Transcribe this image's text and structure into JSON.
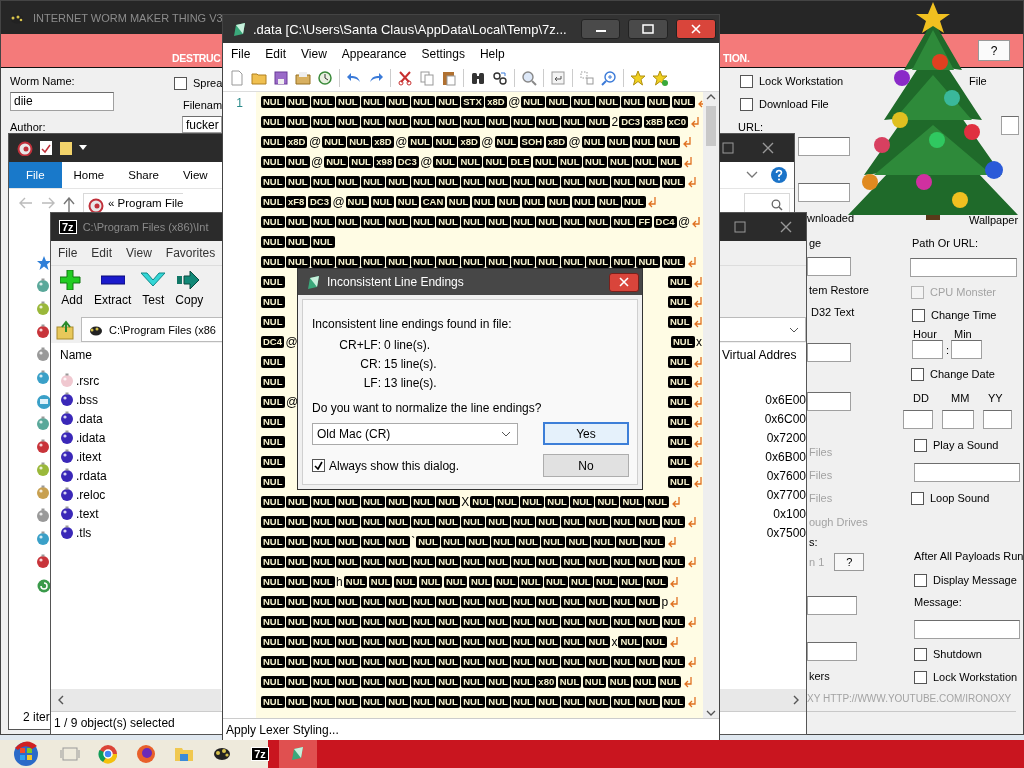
{
  "worm_window": {
    "title": "INTERNET WORM MAKER THING V3",
    "banner": [
      "DESTRUC",
      "TION."
    ],
    "help_button": "?",
    "controls": [
      {
        "kind": "label",
        "text": "Worm Name:",
        "disabled": false
      },
      {
        "kind": "field",
        "value": "diie"
      },
      {
        "kind": "label",
        "text": "Author:",
        "disabled": false
      },
      {
        "kind": "checkbox",
        "text": "Sprea",
        "checked": false,
        "disabled": false
      },
      {
        "kind": "label",
        "text": "Filenam",
        "disabled": false
      },
      {
        "kind": "field",
        "value": "fucker"
      },
      {
        "kind": "checkbox",
        "text": "Lock Workstation",
        "checked": false,
        "disabled": false
      },
      {
        "kind": "checkbox",
        "text": "Download File",
        "checked": false,
        "disabled": false
      },
      {
        "kind": "label",
        "text": "URL:",
        "disabled": false
      },
      {
        "kind": "label",
        "text": "File",
        "disabled": false
      },
      {
        "kind": "field"
      },
      {
        "kind": "field"
      },
      {
        "kind": "field"
      },
      {
        "kind": "label",
        "text": "wnloaded",
        "disabled": false
      },
      {
        "kind": "label",
        "text": "Wallpaper",
        "disabled": false
      },
      {
        "kind": "label",
        "text": "ge",
        "disabled": false
      },
      {
        "kind": "label",
        "text": "Path Or URL:",
        "disabled": false
      },
      {
        "kind": "field"
      },
      {
        "kind": "field"
      },
      {
        "kind": "label",
        "text": "tem Restore",
        "disabled": false
      },
      {
        "kind": "checkbox",
        "text": "CPU Monster",
        "checked": false,
        "disabled": true
      },
      {
        "kind": "label",
        "text": "D32 Text",
        "disabled": false
      },
      {
        "kind": "checkbox",
        "text": "Change Time",
        "checked": false,
        "disabled": false
      },
      {
        "kind": "label",
        "text": "Hour",
        "disabled": false
      },
      {
        "kind": "label",
        "text": "Min",
        "disabled": false
      },
      {
        "kind": "field"
      },
      {
        "kind": "label",
        "text": ":",
        "disabled": false
      },
      {
        "kind": "field"
      },
      {
        "kind": "field"
      },
      {
        "kind": "checkbox",
        "text": "Change Date",
        "checked": false,
        "disabled": false
      },
      {
        "kind": "label",
        "text": "DD",
        "disabled": false
      },
      {
        "kind": "label",
        "text": "MM",
        "disabled": false
      },
      {
        "kind": "label",
        "text": "YY",
        "disabled": false
      },
      {
        "kind": "field"
      },
      {
        "kind": "field"
      },
      {
        "kind": "field"
      },
      {
        "kind": "field"
      },
      {
        "kind": "checkbox",
        "text": "Play a Sound",
        "checked": false,
        "disabled": false
      },
      {
        "kind": "label",
        "text": "Files",
        "disabled": true
      },
      {
        "kind": "field"
      },
      {
        "kind": "label",
        "text": "Files",
        "disabled": true
      },
      {
        "kind": "checkbox",
        "text": "Loop Sound",
        "checked": false,
        "disabled": false
      },
      {
        "kind": "label",
        "text": "Files",
        "disabled": true
      },
      {
        "kind": "label",
        "text": "ough Drives",
        "disabled": true
      },
      {
        "kind": "label",
        "text": "s:",
        "disabled": false
      },
      {
        "kind": "help",
        "text": "n 1",
        "button": "?"
      },
      {
        "kind": "label",
        "text": "After All Payloads Run",
        "disabled": false
      },
      {
        "kind": "checkbox",
        "text": "Display Message",
        "checked": false,
        "disabled": false
      },
      {
        "kind": "label",
        "text": "Message:",
        "disabled": false
      },
      {
        "kind": "field"
      },
      {
        "kind": "field"
      },
      {
        "kind": "field"
      },
      {
        "kind": "checkbox",
        "text": "Shutdown",
        "checked": false,
        "disabled": false
      },
      {
        "kind": "label",
        "text": "kers",
        "disabled": false
      },
      {
        "kind": "checkbox",
        "text": "Lock Workstation",
        "checked": false,
        "disabled": false
      },
      {
        "kind": "label",
        "text": "XY HTTP://WWW.YOUTUBE.COM/IRONOXY",
        "disabled": true
      }
    ]
  },
  "explorer_window": {
    "ribbon_tabs": [
      {
        "label": "File",
        "selected": true
      },
      {
        "label": "Home",
        "selected": false
      },
      {
        "label": "Share",
        "selected": false
      },
      {
        "label": "View",
        "selected": false
      }
    ],
    "address_prefix": "«",
    "address": "Program File",
    "status": "2 iter"
  },
  "archive_window": {
    "logo": "7z",
    "title": "C:\\Program Files (x86)\\Int",
    "menu": [
      "File",
      "Edit",
      "View",
      "Favorites"
    ],
    "toolbar": [
      "Add",
      "Extract",
      "Test",
      "Copy"
    ],
    "path": "C:\\Program Files (x86",
    "columns": [
      "Name",
      "Virtual Addres"
    ],
    "rows": [
      {
        "name": ".rsrc"
      },
      {
        "name": ".bss",
        "virtual_address": "0x6E00"
      },
      {
        "name": ".data",
        "virtual_address": "0x6C00"
      },
      {
        "name": ".idata",
        "virtual_address": "0x7200"
      },
      {
        "name": ".itext",
        "virtual_address": "0x6B00"
      },
      {
        "name": ".rdata",
        "virtual_address": "0x7600"
      },
      {
        "name": ".reloc",
        "virtual_address": "0x7700"
      },
      {
        "name": ".text",
        "virtual_address": "0x100"
      },
      {
        "name": ".tls",
        "virtual_address": "0x7500"
      }
    ],
    "status": "1 / 9 object(s) selected"
  },
  "editor_window": {
    "title": ".data [C:\\Users\\Santa Claus\\AppData\\Local\\Temp\\7z...",
    "menu": [
      "File",
      "Edit",
      "View",
      "Appearance",
      "Settings",
      "Help"
    ],
    "line_number": "1",
    "status": "Apply Lexer Styling...",
    "rows": [
      {
        "tokens": [
          "NUL",
          "NUL",
          "NUL",
          "NUL",
          "NUL",
          "NUL",
          "NUL",
          "NUL",
          "STX",
          "x8D",
          {
            "plain": "@"
          },
          "NUL",
          "NUL",
          "NUL",
          "NUL",
          "NUL",
          "NUL",
          "NUL"
        ],
        "eol": true
      },
      {
        "tokens": [
          "NUL",
          "NUL",
          "NUL",
          "NUL",
          "NUL",
          "NUL",
          "NUL",
          "NUL",
          "NUL",
          "NUL",
          "NUL",
          "NUL",
          "NUL",
          "NUL",
          {
            "plain": "2"
          },
          "DC3",
          "x8B",
          "xC0"
        ],
        "eol": true
      },
      {
        "tokens": [
          "NUL",
          "x8D",
          {
            "plain": "@"
          },
          "NUL",
          "NUL",
          "x8D",
          {
            "plain": "@"
          },
          "NUL",
          "NUL",
          "x8D",
          {
            "plain": "@"
          },
          "NUL",
          "SOH",
          "x8D",
          {
            "plain": "@"
          },
          "NUL",
          "NUL",
          "NUL",
          "NUL"
        ],
        "eol": true
      },
      {
        "tokens": [
          "NUL",
          "NUL",
          {
            "plain": "@"
          },
          "NUL",
          "NUL",
          "x98",
          "DC3",
          {
            "plain": "@"
          },
          "NUL",
          "NUL",
          "NUL",
          "DLE",
          "NUL",
          "NUL",
          "NUL",
          "NUL",
          "NUL",
          "NUL"
        ],
        "eol": true
      },
      {
        "tokens": [
          "NUL",
          "NUL",
          "NUL",
          "NUL",
          "NUL",
          "NUL",
          "NUL",
          "NUL",
          "NUL",
          "NUL",
          "NUL",
          "NUL",
          "NUL",
          "NUL",
          "NUL",
          "NUL",
          "NUL"
        ],
        "eol": true
      },
      {
        "tokens": [
          "NUL",
          "xF8",
          "DC3",
          {
            "plain": "@"
          },
          "NUL",
          "NUL",
          "NUL",
          "CAN",
          "NUL",
          "NUL",
          "NUL",
          "NUL",
          "NUL",
          "NUL",
          "NUL",
          "NUL"
        ],
        "eol": true
      },
      {
        "tokens": [
          "NUL",
          "NUL",
          "NUL",
          "NUL",
          "NUL",
          "NUL",
          "NUL",
          "NUL",
          "NUL",
          "NUL",
          "NUL",
          "NUL",
          "NUL",
          "NUL",
          "NUL",
          "FF",
          "DC4",
          {
            "plain": "@"
          }
        ],
        "eol": true
      },
      {
        "tokens": [
          "NUL",
          "NUL",
          "NUL"
        ],
        "eol": false
      },
      {
        "tokens": [
          "NUL",
          "NUL",
          "NUL",
          "NUL",
          "NUL",
          "NUL",
          "NUL",
          "NUL",
          "NUL",
          "NUL",
          "NUL",
          "NUL",
          "NUL",
          "NUL",
          "NUL",
          "NUL",
          "NUL"
        ],
        "eol": true
      },
      {
        "tokens": [
          "NUL"
        ],
        "tail": [
          "NUL"
        ],
        "eol": true
      },
      {
        "tokens": [
          "NUL"
        ],
        "tail": [
          "NUL"
        ],
        "eol": true
      },
      {
        "tokens": [
          "NUL"
        ],
        "tail": [
          "NUL"
        ],
        "eol": true
      },
      {
        "tokens": [
          "DC4",
          {
            "plain": "@"
          }
        ],
        "tail": [
          "NUL",
          {
            "plain": "x"
          }
        ],
        "eol": false
      },
      {
        "tokens": [
          "NUL"
        ],
        "tail": [
          "NUL"
        ],
        "eol": true
      },
      {
        "tokens": [
          "NUL"
        ],
        "tail": [
          "NUL"
        ],
        "eol": true
      },
      {
        "tokens": [
          "NUL",
          {
            "plain": "@"
          }
        ],
        "tail": [
          "NUL"
        ],
        "eol": true
      },
      {
        "tokens": [
          "NUL"
        ],
        "tail": [
          "NUL"
        ],
        "eol": true
      },
      {
        "tokens": [
          "NUL"
        ],
        "tail": [
          "NUL"
        ],
        "eol": true
      },
      {
        "tokens": [
          "NUL"
        ],
        "tail": [
          "NUL"
        ],
        "eol": true
      },
      {
        "tokens": [
          "NUL"
        ],
        "tail": [
          "NUL"
        ],
        "eol": true
      },
      {
        "tokens": [
          "NUL",
          "NUL",
          "NUL",
          "NUL",
          "NUL",
          "NUL",
          "NUL",
          "NUL",
          {
            "plain": "X"
          },
          "NUL",
          "NUL",
          "NUL",
          "NUL",
          "NUL",
          "NUL",
          "NUL",
          "NUL"
        ],
        "eol": true
      },
      {
        "tokens": [
          "NUL",
          "NUL",
          "NUL",
          "NUL",
          "NUL",
          "NUL",
          "NUL",
          "NUL",
          "NUL",
          "NUL",
          "NUL",
          "NUL",
          "NUL",
          "NUL",
          "NUL",
          "NUL",
          "NUL"
        ],
        "eol": true
      },
      {
        "tokens": [
          "NUL",
          "NUL",
          "NUL",
          "NUL",
          "NUL",
          "NUL",
          {
            "plain": "`"
          },
          "NUL",
          "NUL",
          "NUL",
          "NUL",
          "NUL",
          "NUL",
          "NUL",
          "NUL",
          "NUL",
          "NUL"
        ],
        "eol": true
      },
      {
        "tokens": [
          "NUL",
          "NUL",
          "NUL",
          "NUL",
          "NUL",
          "NUL",
          "NUL",
          "NUL",
          "NUL",
          "NUL",
          "NUL",
          "NUL",
          "NUL",
          "NUL",
          "NUL",
          "NUL",
          "NUL"
        ],
        "eol": true
      },
      {
        "tokens": [
          "NUL",
          "NUL",
          "NUL",
          {
            "plain": "h"
          },
          "NUL",
          "NUL",
          "NUL",
          "NUL",
          "NUL",
          "NUL",
          "NUL",
          "NUL",
          "NUL",
          "NUL",
          "NUL",
          "NUL",
          "NUL"
        ],
        "eol": true
      },
      {
        "tokens": [
          "NUL",
          "NUL",
          "NUL",
          "NUL",
          "NUL",
          "NUL",
          "NUL",
          "NUL",
          "NUL",
          "NUL",
          "NUL",
          "NUL",
          "NUL",
          "NUL",
          "NUL",
          "NUL",
          {
            "plain": "p"
          }
        ],
        "eol": true
      },
      {
        "tokens": [
          "NUL",
          "NUL",
          "NUL",
          "NUL",
          "NUL",
          "NUL",
          "NUL",
          "NUL",
          "NUL",
          "NUL",
          "NUL",
          "NUL",
          "NUL",
          "NUL",
          "NUL",
          "NUL",
          "NUL"
        ],
        "eol": true
      },
      {
        "tokens": [
          "NUL",
          "NUL",
          "NUL",
          "NUL",
          "NUL",
          "NUL",
          "NUL",
          "NUL",
          "NUL",
          "NUL",
          "NUL",
          "NUL",
          "NUL",
          "NUL",
          {
            "plain": "x"
          },
          "NUL",
          "NUL"
        ],
        "eol": true
      },
      {
        "tokens": [
          "NUL",
          "NUL",
          "NUL",
          "NUL",
          "NUL",
          "NUL",
          "NUL",
          "NUL",
          "NUL",
          "NUL",
          "NUL",
          "NUL",
          "NUL",
          "NUL",
          "NUL",
          "NUL",
          "NUL"
        ],
        "eol": true
      },
      {
        "tokens": [
          "NUL",
          "NUL",
          "NUL",
          "NUL",
          "NUL",
          "NUL",
          "NUL",
          "NUL",
          "NUL",
          "NUL",
          "NUL",
          "x80",
          "NUL",
          "NUL",
          "NUL",
          "NUL",
          "NUL"
        ],
        "eol": true
      },
      {
        "tokens": [
          "NUL",
          "NUL",
          "NUL",
          "NUL",
          "NUL",
          "NUL",
          "NUL",
          "NUL",
          "NUL",
          "NUL",
          "NUL",
          "NUL",
          "NUL",
          "NUL",
          "NUL",
          "NUL",
          "NUL"
        ],
        "eol": true
      }
    ]
  },
  "dialog": {
    "title": "Inconsistent Line Endings",
    "message": "Inconsistent line endings found in file:",
    "counts": [
      {
        "label": "CR+LF:",
        "value": "0 line(s)."
      },
      {
        "label": "CR:",
        "value": "15 line(s)."
      },
      {
        "label": "LF:",
        "value": "13 line(s)."
      }
    ],
    "question": "Do you want to normalize the line endings?",
    "select": "Old Mac (CR)",
    "always_show": {
      "label": "Always show this dialog.",
      "checked": true
    },
    "buttons": [
      {
        "label": "Yes",
        "focused": true
      },
      {
        "label": "No",
        "focused": false
      }
    ]
  },
  "taskbar": {
    "items": [
      {
        "kind": "start",
        "active": false
      },
      {
        "kind": "task_view",
        "active": false
      },
      {
        "kind": "browser",
        "active": false
      },
      {
        "kind": "firefox",
        "active": false
      },
      {
        "kind": "folder",
        "active": false
      },
      {
        "kind": "worm",
        "active": false
      },
      {
        "kind": "archive",
        "label": "7z",
        "active": false
      },
      {
        "kind": "editor",
        "active": true
      }
    ]
  }
}
